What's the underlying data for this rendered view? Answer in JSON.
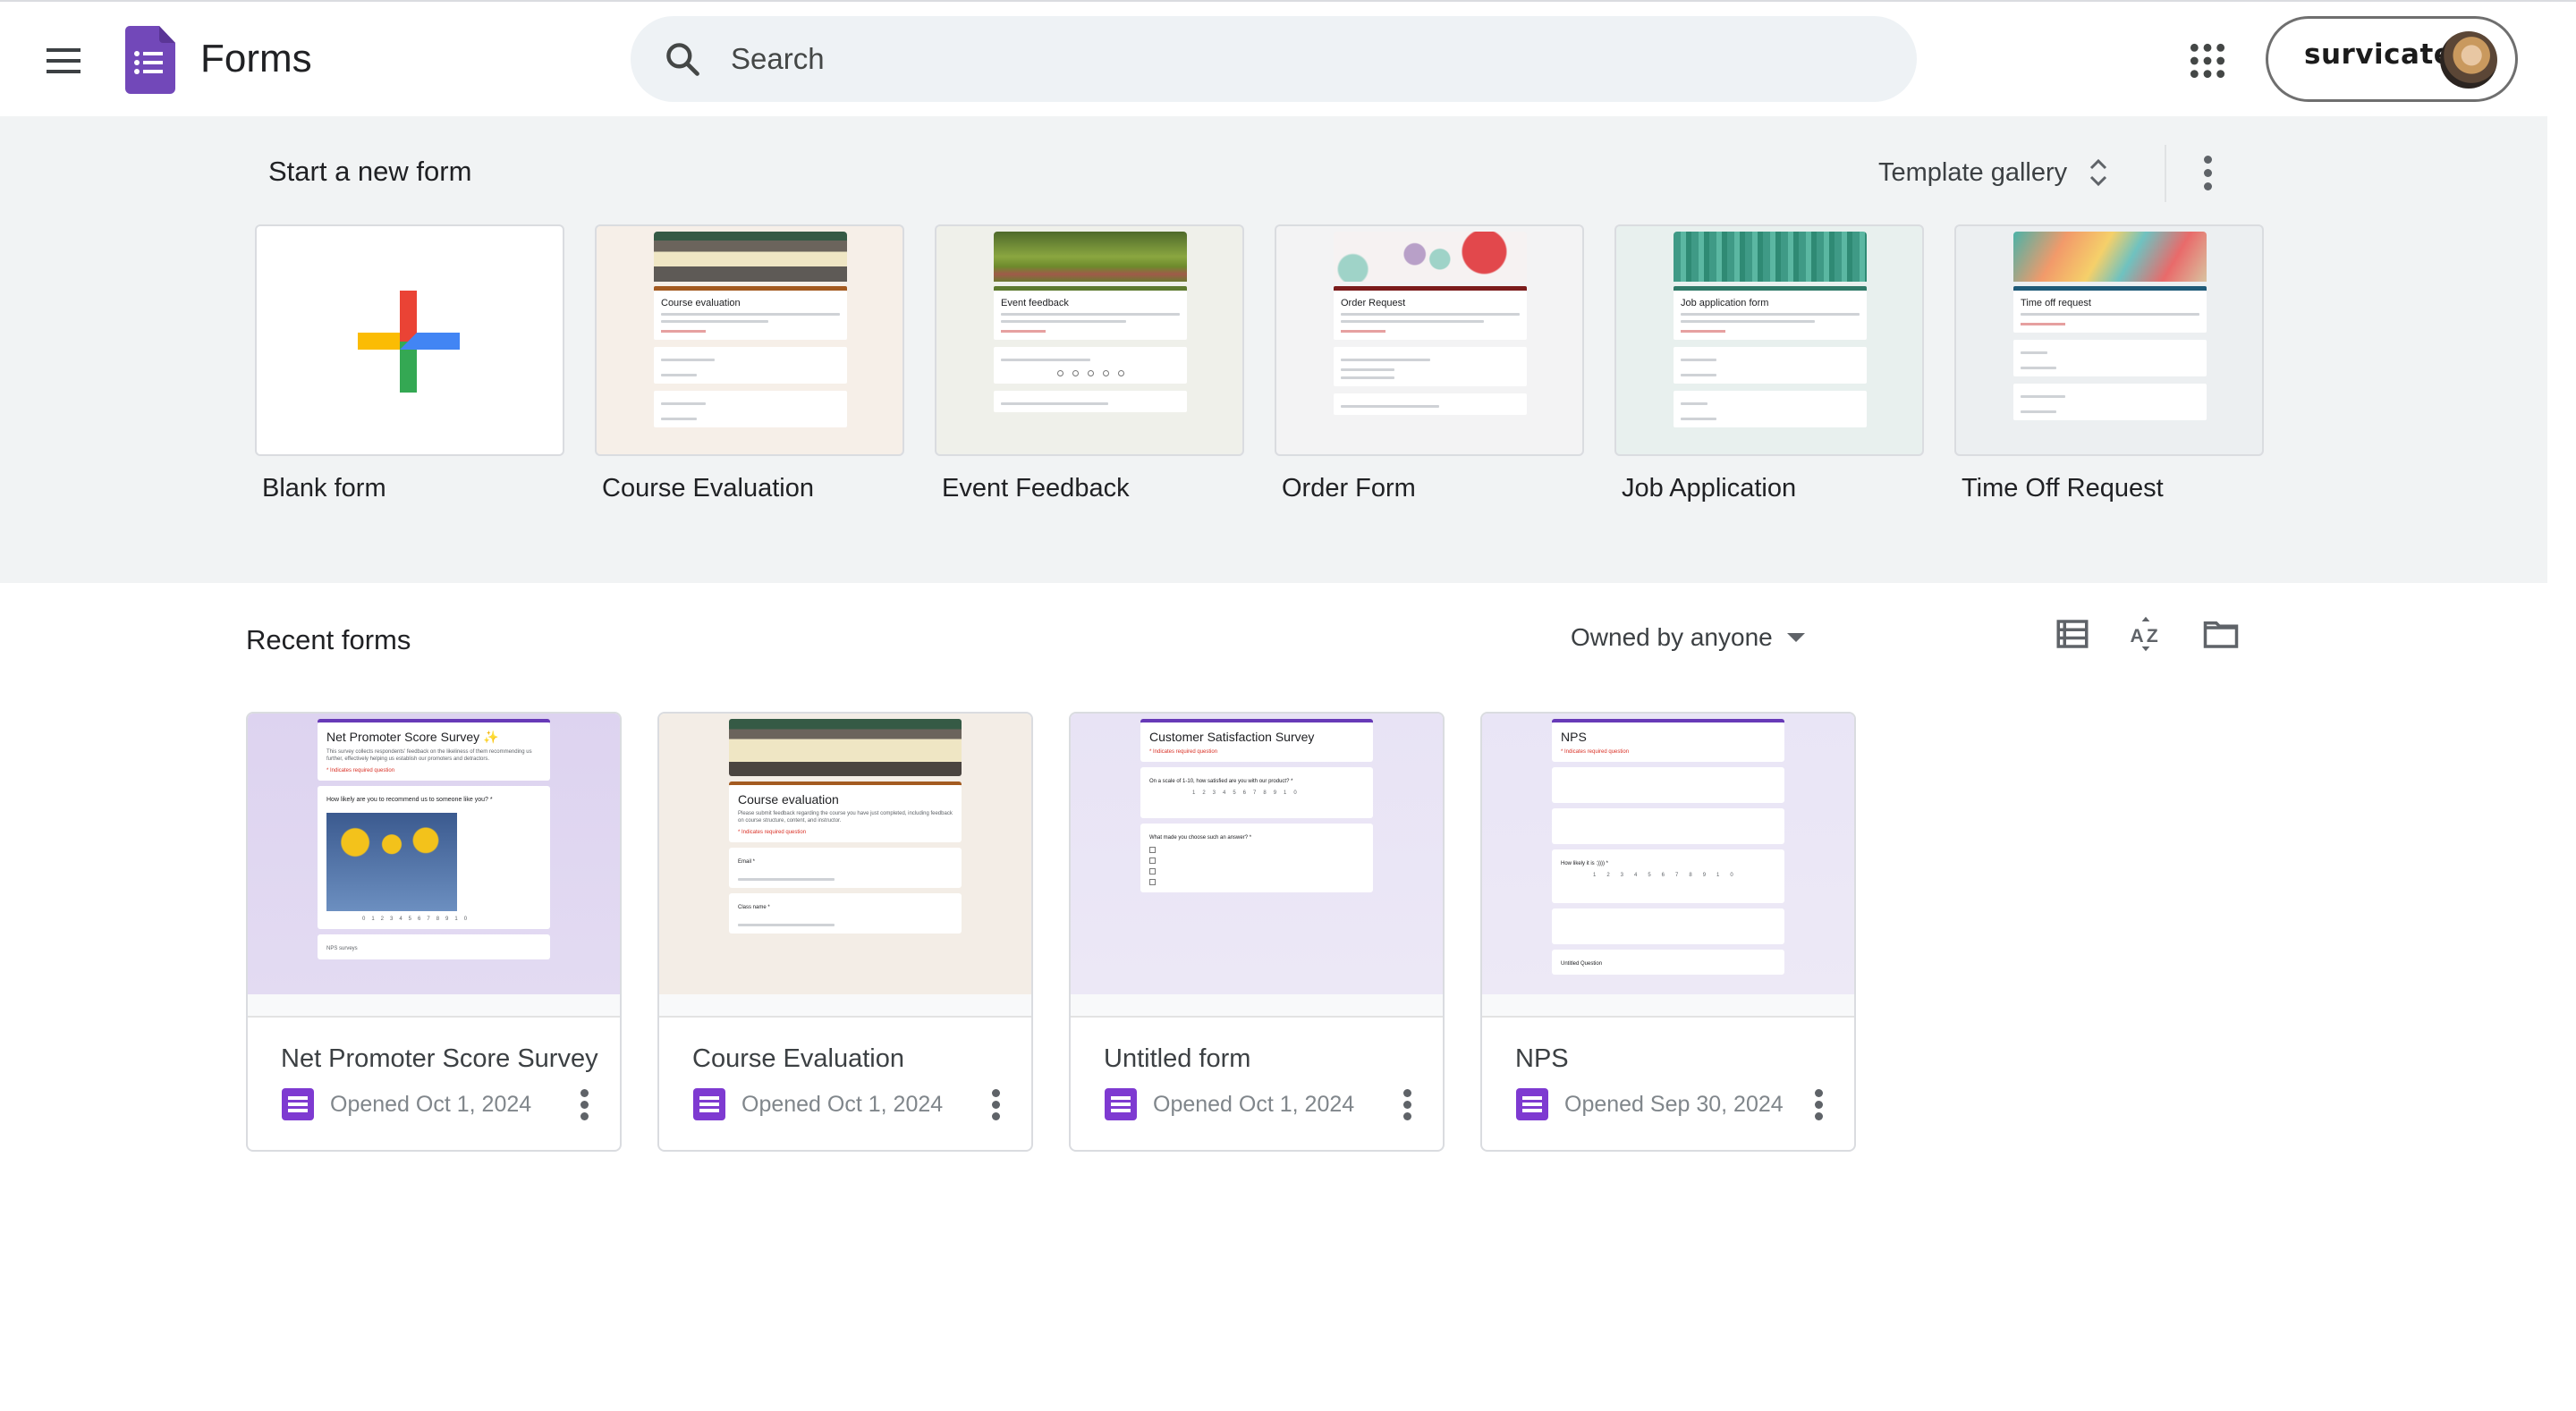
{
  "header": {
    "app_name": "Forms",
    "search_placeholder": "Search",
    "account_label": "survicate",
    "icons": {
      "menu": "hamburger-menu-icon",
      "logo": "google-forms-logo",
      "search": "search-icon",
      "apps": "google-apps-grid-icon",
      "avatar": "user-avatar"
    }
  },
  "templates": {
    "title": "Start a new form",
    "gallery_label": "Template gallery",
    "items": [
      {
        "label": "Blank form",
        "thumb_title": ""
      },
      {
        "label": "Course Evaluation",
        "thumb_title": "Course evaluation",
        "accent": "#a35a20"
      },
      {
        "label": "Event Feedback",
        "thumb_title": "Event feedback",
        "accent": "#5d7a2f"
      },
      {
        "label": "Order Form",
        "thumb_title": "Order Request",
        "accent": "#7b1c1c"
      },
      {
        "label": "Job Application",
        "thumb_title": "Job application form",
        "accent": "#2f7a68"
      },
      {
        "label": "Time Off Request",
        "thumb_title": "Time off request",
        "accent": "#1f5a78"
      }
    ]
  },
  "recent": {
    "title": "Recent forms",
    "owner_filter": "Owned by anyone",
    "toolbar_icons": [
      "list-view-icon",
      "sort-az-icon",
      "folder-icon"
    ],
    "items": [
      {
        "title": "Net Promoter Score Survey",
        "opened": "Opened Oct 1, 2024",
        "thumb_title": "Net Promoter Score Survey ✨",
        "thumb_desc": "This survey collects respondents' feedback on the likeliness of them recommending us further, effectively helping us establish our promoters and detractors.",
        "thumb_required": "* Indicates required question",
        "thumb_question": "How likely are you to recommend us to someone like you? *",
        "thumb_footer": "NPS surveys"
      },
      {
        "title": "Course Evaluation",
        "opened": "Opened Oct 1, 2024",
        "thumb_title": "Course evaluation",
        "thumb_desc": "Please submit feedback regarding the course you have just completed, including feedback on course structure, content, and instructor.",
        "thumb_required": "* Indicates required question",
        "thumb_question": "Email *",
        "thumb_footer": "Class name *"
      },
      {
        "title": "Untitled form",
        "opened": "Opened Oct 1, 2024",
        "thumb_title": "Customer Satisfaction Survey",
        "thumb_desc": "",
        "thumb_required": "* Indicates required question",
        "thumb_question": "On a scale of 1-10, how satisfied are you with our product? *",
        "thumb_footer": "What made you choose such an answer? *"
      },
      {
        "title": "NPS",
        "opened": "Opened Sep 30, 2024",
        "thumb_title": "NPS",
        "thumb_desc": "",
        "thumb_required": "* Indicates required question",
        "thumb_question": "How likely it is :)))) *",
        "thumb_footer": "Untitled Question"
      }
    ]
  },
  "colors": {
    "forms_purple": "#7248b9",
    "form_icon_purple": "#7e3ad1",
    "template_bg": "#f1f3f4"
  }
}
